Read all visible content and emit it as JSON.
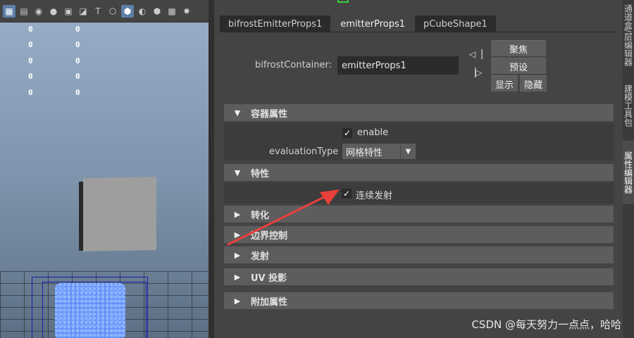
{
  "viewport": {
    "hud_values": [
      [
        "0",
        "0"
      ],
      [
        "0",
        "0"
      ],
      [
        "0",
        "0"
      ],
      [
        "0",
        "0"
      ],
      [
        "0",
        "0"
      ]
    ],
    "toolbar_icons": [
      "grid-icon",
      "film-icon",
      "camera-icon",
      "camera-filled-icon",
      "frame-icon",
      "image-icon",
      "text-icon",
      "wire-cube-icon",
      "shaded-cube-icon",
      "sphere-icon",
      "textured-cube-icon",
      "checker-icon",
      "light-icon"
    ]
  },
  "attribute_editor": {
    "tabs": [
      {
        "label": "bifrostEmitterProps1",
        "active": false
      },
      {
        "label": "emitterProps1",
        "active": true
      },
      {
        "label": "pCubeShape1",
        "active": false
      }
    ],
    "container_label": "bifrostContainer:",
    "container_value": "emitterProps1",
    "buttons": {
      "focus": "聚焦",
      "preset": "预设",
      "show": "显示",
      "hide": "隐藏"
    },
    "sections": {
      "container_attrs": "容器属性",
      "properties": "特性",
      "transform": "转化",
      "boundary": "边界控制",
      "emission": "发射",
      "uv_projection": "UV 投影",
      "extra_attrs": "附加属性"
    },
    "enable_label": "enable",
    "enable_checked": true,
    "evaluation_type_label": "evaluationType",
    "evaluation_type_value": "网格特性",
    "continuous_emission_label": "连续发射",
    "continuous_emission_checked": true
  },
  "right_tabs": [
    {
      "label": "通道盒/层编辑器",
      "active": false
    },
    {
      "label": "建模工具包",
      "active": false
    },
    {
      "label": "属性编辑器",
      "active": true
    }
  ],
  "watermark": "CSDN @每天努力一点点，哈哈",
  "colors": {
    "accent_arrow": "#e8403a",
    "active_icon": "#5d7fa8",
    "panel": "#444444",
    "section_header": "#5d5d5d"
  }
}
